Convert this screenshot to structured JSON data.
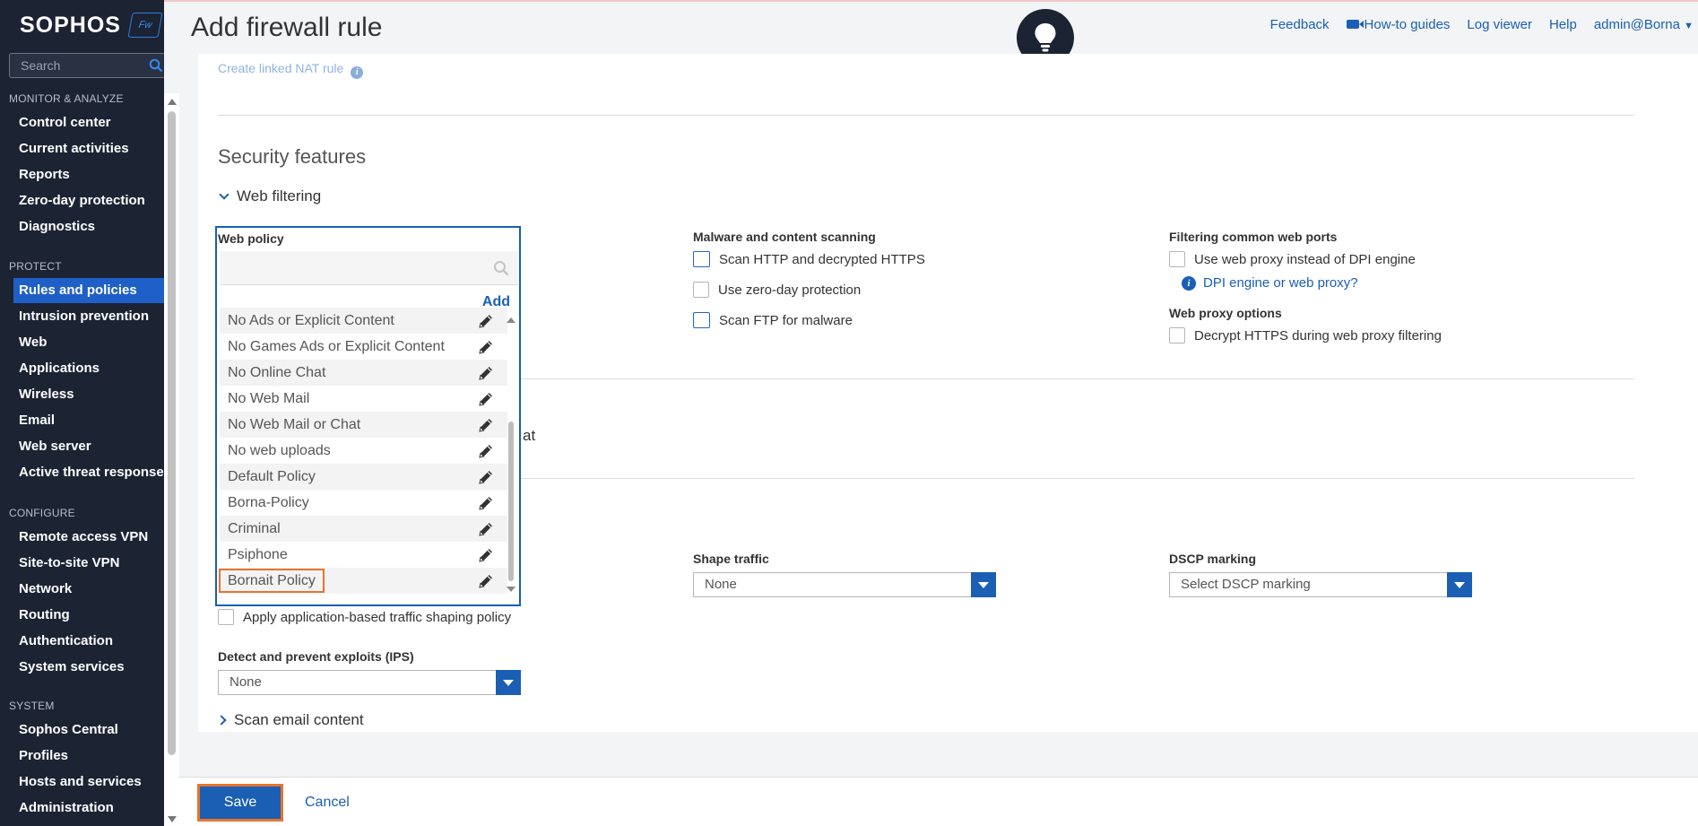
{
  "app": {
    "logo_text": "SOPHOS",
    "logo_badge": "Fw",
    "page_title": "Add firewall rule"
  },
  "header": {
    "links": [
      "Feedback",
      "How-to guides",
      "Log viewer",
      "Help",
      "admin@Borna"
    ]
  },
  "sidebar": {
    "search_placeholder": "Search",
    "sections": [
      {
        "title": "MONITOR & ANALYZE",
        "items": [
          "Control center",
          "Current activities",
          "Reports",
          "Zero-day protection",
          "Diagnostics"
        ]
      },
      {
        "title": "PROTECT",
        "items": [
          "Rules and policies",
          "Intrusion prevention",
          "Web",
          "Applications",
          "Wireless",
          "Email",
          "Web server",
          "Active threat response"
        ]
      },
      {
        "title": "CONFIGURE",
        "items": [
          "Remote access VPN",
          "Site-to-site VPN",
          "Network",
          "Routing",
          "Authentication",
          "System services"
        ]
      },
      {
        "title": "SYSTEM",
        "items": [
          "Sophos Central",
          "Profiles",
          "Hosts and services",
          "Administration"
        ]
      }
    ],
    "active_item": "Rules and policies"
  },
  "main": {
    "faded_link": "Create linked NAT rule",
    "section_title": "Security features",
    "web_filtering": "Web filtering",
    "web_policy": {
      "label": "Web policy",
      "search_value": "",
      "add_label": "Add",
      "options": [
        "No Ads or Explicit Content",
        "No Games Ads or Explicit Content",
        "No Online Chat",
        "No Web Mail",
        "No Web Mail or Chat",
        "No web uploads",
        "Default Policy",
        "Borna-Policy",
        "Criminal",
        "Psiphone",
        "Bornait Policy"
      ],
      "highlighted": "Bornait Policy"
    },
    "malware": {
      "label": "Malware and content scanning",
      "options": [
        "Scan HTTP and decrypted HTTPS",
        "Use zero-day protection",
        "Scan FTP for malware"
      ]
    },
    "web_ports": {
      "label": "Filtering common web ports",
      "option": "Use web proxy instead of DPI engine",
      "help_link": "DPI engine or web proxy?"
    },
    "proxy_options": {
      "label": "Web proxy options",
      "option": "Decrypt HTTPS during web proxy filtering"
    },
    "hidden_text_fragment": "at",
    "shape_traffic": {
      "label": "Shape traffic",
      "value": "None"
    },
    "dscp": {
      "label": "DSCP marking",
      "value": "Select DSCP marking"
    },
    "app_shaping": "Apply application-based traffic shaping policy",
    "ips": {
      "label": "Detect and prevent exploits (IPS)",
      "value": "None"
    },
    "scan_email": "Scan email content"
  },
  "footer": {
    "save": "Save",
    "cancel": "Cancel"
  }
}
